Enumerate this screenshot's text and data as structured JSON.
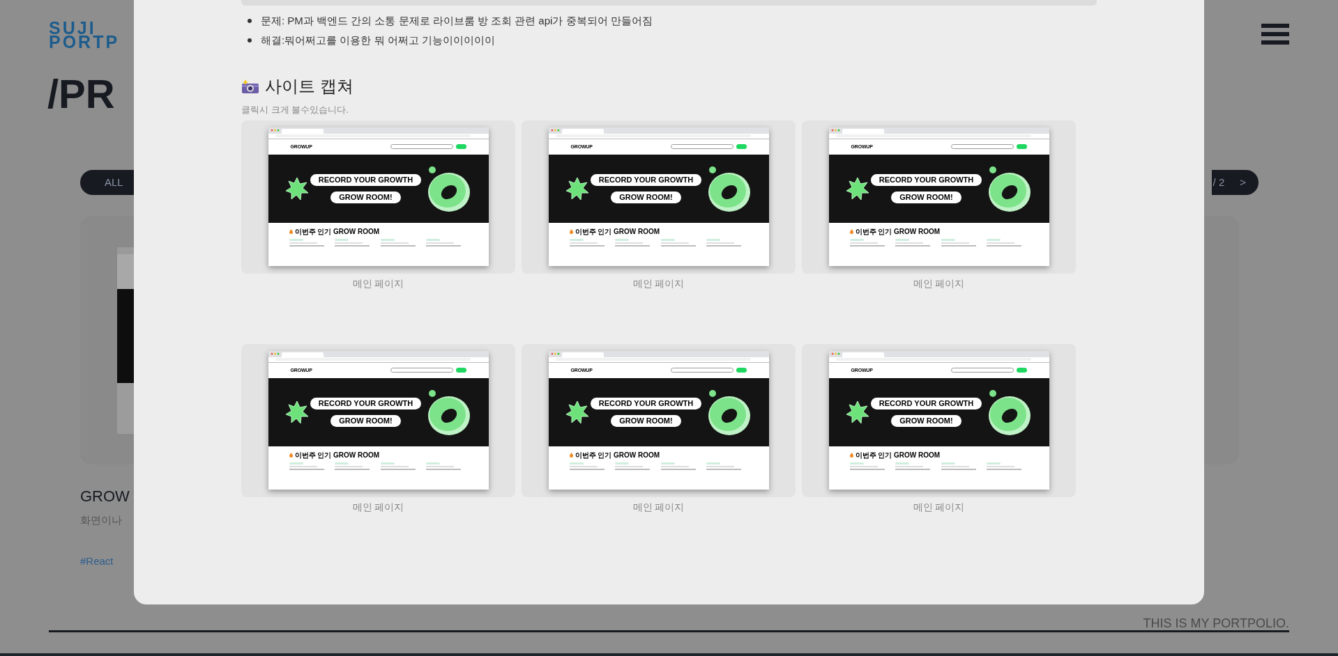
{
  "background_page": {
    "logo_lines": [
      "SUJI",
      "PORTP"
    ],
    "page_title": "/PR",
    "filter_button": "ALL",
    "pagination": {
      "page": "/ 2",
      "next": ">"
    },
    "project": {
      "title": "GROW",
      "description": "화면이나",
      "tags": [
        "#React"
      ]
    },
    "footer": "THIS IS MY PORTPOLIO."
  },
  "modal": {
    "bullets": [
      "문제: PM과 백엔드 간의 소통 문제로 라이브룸 방 조회 관련 api가 중복되어 만들어짐",
      "해결:뭐어쩌고를 이용한 뭐 어쩌고 기능이이이이이"
    ],
    "section_title": "사이트 캡쳐",
    "section_hint": "클릭시 크게 볼수있습니다.",
    "captures": [
      {
        "site": {
          "logo": "GROWUP",
          "hero_lines": [
            "RECORD YOUR GROWTH",
            "GROW ROOM!"
          ],
          "section_title": "이번주 인기 GROW ROOM"
        },
        "caption": "메인 페이지"
      },
      {
        "site": {
          "logo": "GROWUP",
          "hero_lines": [
            "RECORD YOUR GROWTH",
            "GROW ROOM!"
          ],
          "section_title": "이번주 인기 GROW ROOM"
        },
        "caption": "메인 페이지"
      },
      {
        "site": {
          "logo": "GROWUP",
          "hero_lines": [
            "RECORD YOUR GROWTH",
            "GROW ROOM!"
          ],
          "section_title": "이번주 인기 GROW ROOM"
        },
        "caption": "메인 페이지"
      },
      {
        "site": {
          "logo": "GROWUP",
          "hero_lines": [
            "RECORD YOUR GROWTH",
            "GROW ROOM!"
          ],
          "section_title": "이번주 인기 GROW ROOM"
        },
        "caption": "메인 페이지"
      },
      {
        "site": {
          "logo": "GROWUP",
          "hero_lines": [
            "RECORD YOUR GROWTH",
            "GROW ROOM!"
          ],
          "section_title": "이번주 인기 GROW ROOM"
        },
        "caption": "메인 페이지"
      },
      {
        "site": {
          "logo": "GROWUP",
          "hero_lines": [
            "RECORD YOUR GROWTH",
            "GROW ROOM!"
          ],
          "section_title": "이번주 인기 GROW ROOM"
        },
        "caption": "메인 페이지"
      }
    ]
  }
}
